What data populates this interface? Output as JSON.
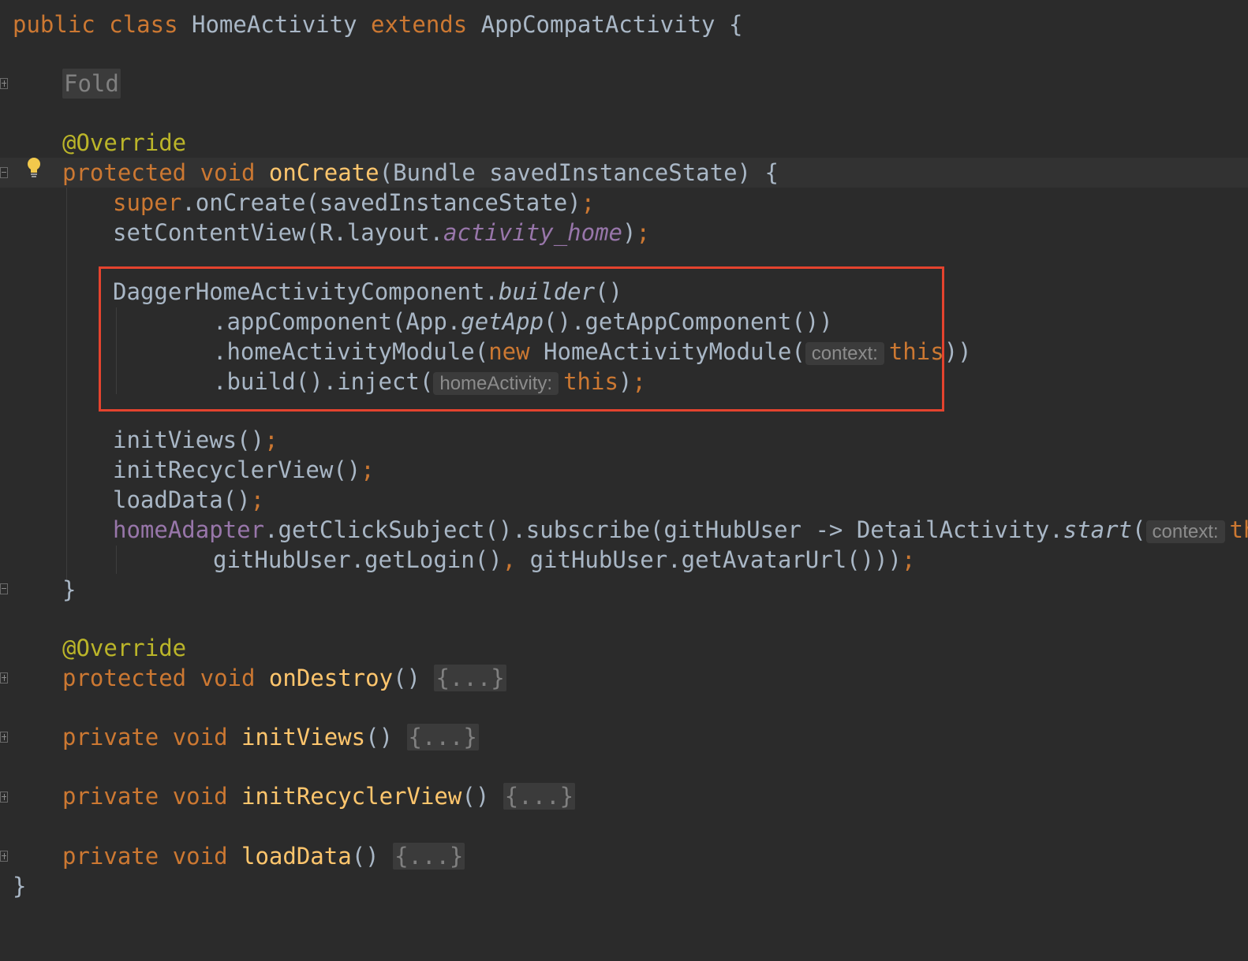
{
  "editor": {
    "class_decl": {
      "kw1": "public",
      "kw2": "class",
      "name": "HomeActivity",
      "kw3": "extends",
      "parent": "AppCompatActivity",
      "brace": "{"
    },
    "fold1": "Fold",
    "override1": "@Override",
    "oncreate": {
      "kw1": "protected",
      "kw2": "void",
      "name": "onCreate",
      "rest": "(Bundle savedInstanceState) {"
    },
    "super_line": {
      "kw": "super",
      "rest": ".onCreate(savedInstanceState)",
      "semi": ";"
    },
    "setcontent": {
      "a": "setContentView(R.layout.",
      "field": "activity_home",
      "b": ")",
      "semi": ";"
    },
    "dagger1": {
      "a": "DaggerHomeActivityComponent.",
      "static": "builder",
      "b": "()"
    },
    "dagger2": {
      "a": ".appComponent(App.",
      "static": "getApp",
      "b": "().getAppComponent())"
    },
    "dagger3": {
      "a": ".homeActivityModule(",
      "kw": "new",
      "b": " HomeActivityModule(",
      "hint": "context:",
      "this": "this",
      "c": "))"
    },
    "dagger4": {
      "a": ".build().inject(",
      "hint": "homeActivity:",
      "this": "this",
      "b": ")",
      "semi": ";"
    },
    "initviews": {
      "a": "initViews()",
      "semi": ";"
    },
    "initrecycler": {
      "a": "initRecyclerView()",
      "semi": ";"
    },
    "loaddata": {
      "a": "loadData()",
      "semi": ";"
    },
    "adapter1": {
      "field": "homeAdapter",
      "a": ".getClickSubject().subscribe(gitHubUser -> DetailActivity.",
      "static": "start",
      "b": "(",
      "hint": "context:",
      "this": "this",
      "comma": ","
    },
    "adapter2": {
      "a": "gitHubUser.getLogin()",
      "comma": ",",
      "b": " gitHubUser.getAvatarUrl()))",
      "semi": ";"
    },
    "close_brace": "}",
    "override2": "@Override",
    "ondestroy": {
      "kw1": "protected",
      "kw2": "void",
      "name": "onDestroy",
      "paren": "()",
      "fold": "{...}"
    },
    "initviews_decl": {
      "kw1": "private",
      "kw2": "void",
      "name": "initViews",
      "paren": "()",
      "fold": "{...}"
    },
    "initrecycler_decl": {
      "kw1": "private",
      "kw2": "void",
      "name": "initRecyclerView",
      "paren": "()",
      "fold": "{...}"
    },
    "loaddata_decl": {
      "kw1": "private",
      "kw2": "void",
      "name": "loadData",
      "paren": "()",
      "fold": "{...}"
    },
    "class_close": "}"
  },
  "colors": {
    "background": "#2b2b2b",
    "text": "#a9b7c6",
    "keyword": "#cc7832",
    "method": "#ffc66d",
    "annotation": "#bbb529",
    "field": "#9876aa",
    "highlight_box": "#e4432e"
  }
}
